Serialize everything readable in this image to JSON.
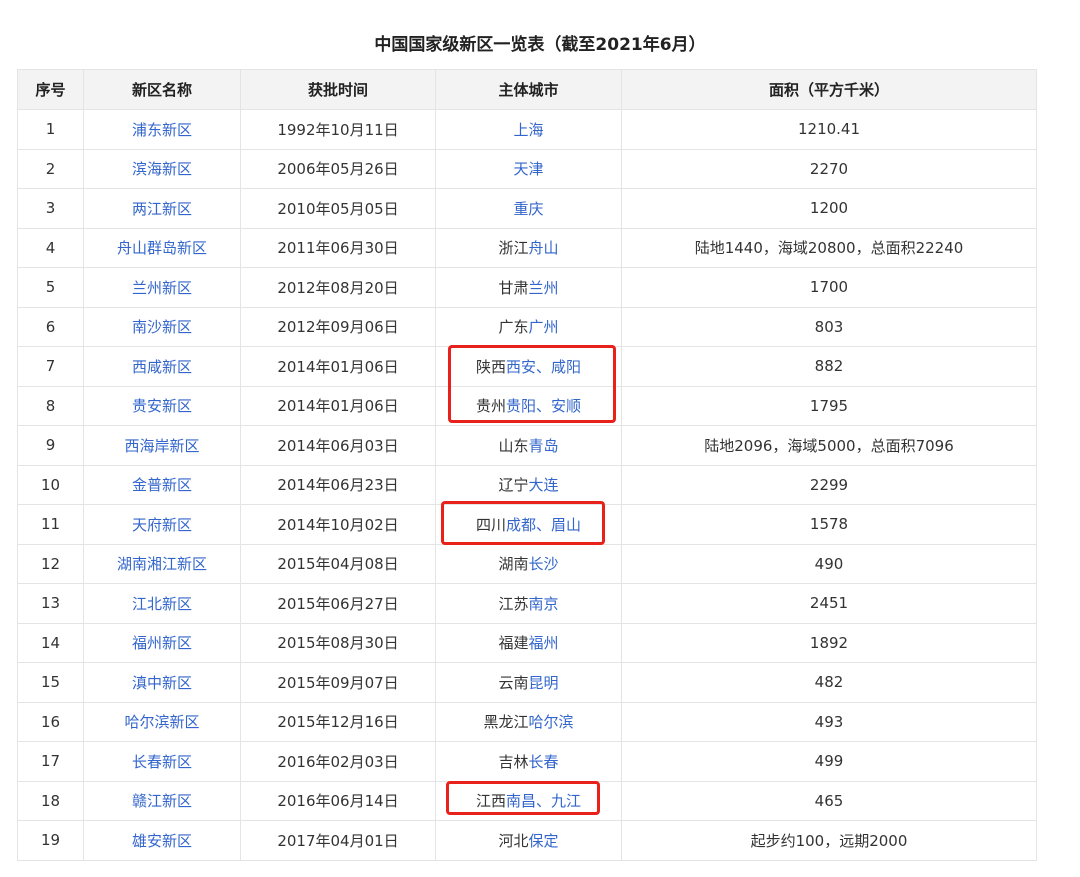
{
  "title": "中国国家级新区一览表（截至2021年6月）",
  "columns": [
    "序号",
    "新区名称",
    "获批时间",
    "主体城市",
    "面积（平方千米）"
  ],
  "rows": [
    {
      "no": "1",
      "name": "浦东新区",
      "date": "1992年10月11日",
      "city_prefix": "",
      "city_link": "上海",
      "area": "1210.41"
    },
    {
      "no": "2",
      "name": "滨海新区",
      "date": "2006年05月26日",
      "city_prefix": "",
      "city_link": "天津",
      "area": "2270"
    },
    {
      "no": "3",
      "name": "两江新区",
      "date": "2010年05月05日",
      "city_prefix": "",
      "city_link": "重庆",
      "area": "1200"
    },
    {
      "no": "4",
      "name": "舟山群岛新区",
      "date": "2011年06月30日",
      "city_prefix": "浙江",
      "city_link": "舟山",
      "area": "陆地1440，海域20800，总面积22240"
    },
    {
      "no": "5",
      "name": "兰州新区",
      "date": "2012年08月20日",
      "city_prefix": "甘肃",
      "city_link": "兰州",
      "area": "1700"
    },
    {
      "no": "6",
      "name": "南沙新区",
      "date": "2012年09月06日",
      "city_prefix": "广东",
      "city_link": "广州",
      "area": "803"
    },
    {
      "no": "7",
      "name": "西咸新区",
      "date": "2014年01月06日",
      "city_prefix": "陕西",
      "city_link": "西安、咸阳",
      "area": "882"
    },
    {
      "no": "8",
      "name": "贵安新区",
      "date": "2014年01月06日",
      "city_prefix": "贵州",
      "city_link": "贵阳、安顺",
      "area": "1795"
    },
    {
      "no": "9",
      "name": "西海岸新区",
      "date": "2014年06月03日",
      "city_prefix": "山东",
      "city_link": "青岛",
      "area": "陆地2096，海域5000，总面积7096"
    },
    {
      "no": "10",
      "name": "金普新区",
      "date": "2014年06月23日",
      "city_prefix": "辽宁",
      "city_link": "大连",
      "area": "2299"
    },
    {
      "no": "11",
      "name": "天府新区",
      "date": "2014年10月02日",
      "city_prefix": "四川",
      "city_link": "成都、眉山",
      "area": "1578"
    },
    {
      "no": "12",
      "name": "湖南湘江新区",
      "date": "2015年04月08日",
      "city_prefix": "湖南",
      "city_link": "长沙",
      "area": "490"
    },
    {
      "no": "13",
      "name": "江北新区",
      "date": "2015年06月27日",
      "city_prefix": "江苏",
      "city_link": "南京",
      "area": "2451"
    },
    {
      "no": "14",
      "name": "福州新区",
      "date": "2015年08月30日",
      "city_prefix": "福建",
      "city_link": "福州",
      "area": "1892"
    },
    {
      "no": "15",
      "name": "滇中新区",
      "date": "2015年09月07日",
      "city_prefix": "云南",
      "city_link": "昆明",
      "area": "482"
    },
    {
      "no": "16",
      "name": "哈尔滨新区",
      "date": "2015年12月16日",
      "city_prefix": "黑龙江",
      "city_link": "哈尔滨",
      "area": "493"
    },
    {
      "no": "17",
      "name": "长春新区",
      "date": "2016年02月03日",
      "city_prefix": "吉林",
      "city_link": "长春",
      "area": "499"
    },
    {
      "no": "18",
      "name": "赣江新区",
      "date": "2016年06月14日",
      "city_prefix": "江西",
      "city_link": "南昌、九江",
      "area": "465"
    },
    {
      "no": "19",
      "name": "雄安新区",
      "date": "2017年04月01日",
      "city_prefix": "河北",
      "city_link": "保定",
      "area": "起步约100，远期2000"
    }
  ],
  "colors": {
    "link": "#3366cc",
    "highlight": "#e8221a",
    "header_bg": "#f3f3f3",
    "border": "#e4e4e4"
  }
}
